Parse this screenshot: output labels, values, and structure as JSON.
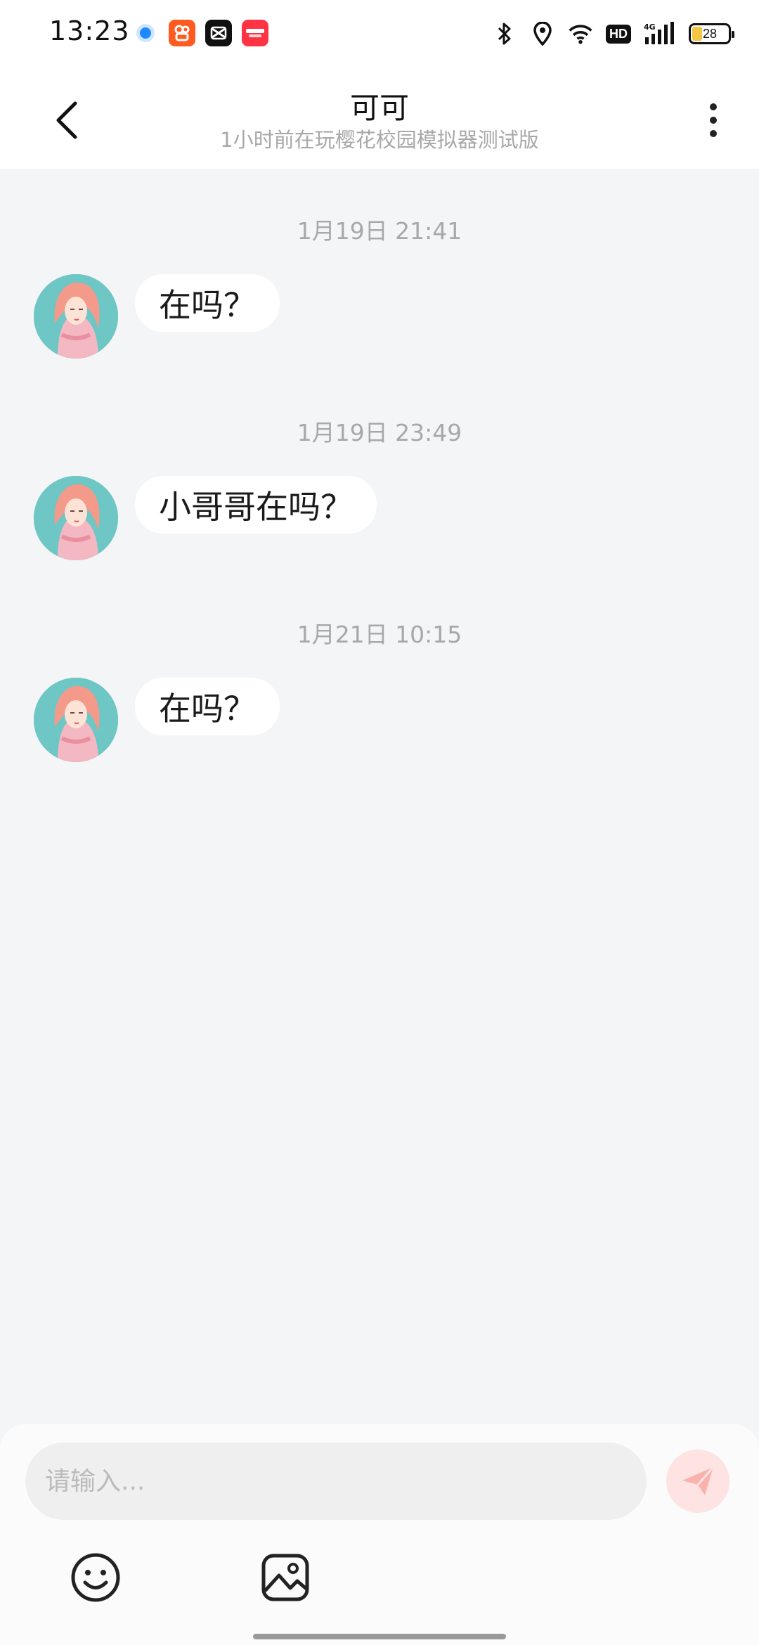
{
  "status_bar": {
    "time": "13:23",
    "app_icons": [
      "browser-icon",
      "kuaishou-icon",
      "capcut-icon",
      "xiaohongshu-icon"
    ],
    "indicators": [
      "bluetooth-icon",
      "location-icon",
      "wifi-icon",
      "hd-icon",
      "4g-signal-icon"
    ],
    "hd_label": "HD",
    "battery_level": "28"
  },
  "header": {
    "title": "可可",
    "subtitle": "1小时前在玩樱花校园模拟器测试版"
  },
  "messages": [
    {
      "timestamp": "1月19日 21:41",
      "text": "在吗？"
    },
    {
      "timestamp": "1月19日 23:49",
      "text": "小哥哥在吗？"
    },
    {
      "timestamp": "1月21日 10:15",
      "text": "在吗？"
    }
  ],
  "composer": {
    "placeholder": "请输入..."
  },
  "colors": {
    "background": "#f4f5f7",
    "bubble": "#ffffff",
    "send_button": "#fde3e2",
    "send_icon": "#f9b2ad",
    "timestamp_text": "#a8a8a8"
  }
}
